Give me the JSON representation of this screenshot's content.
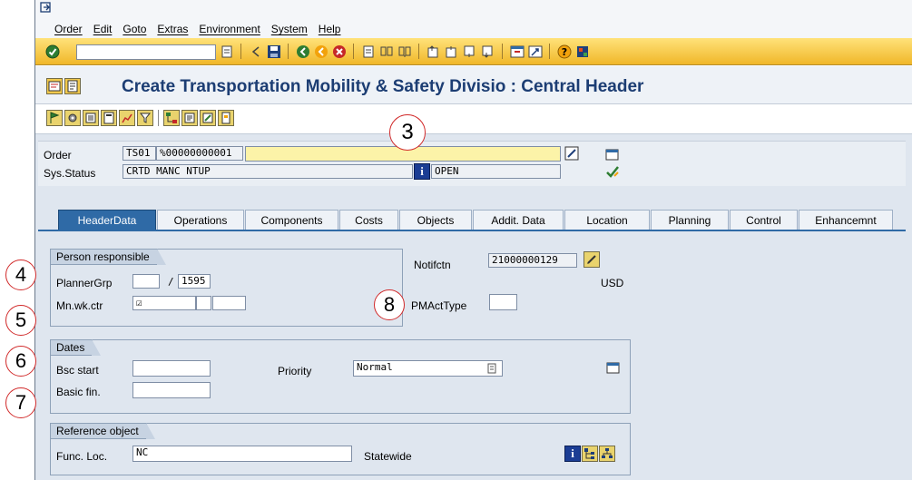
{
  "menu": [
    "Order",
    "Edit",
    "Goto",
    "Extras",
    "Environment",
    "System",
    "Help"
  ],
  "toolbar": {
    "command_value": "",
    "icons": [
      "enter-icon",
      "command-dropdown-icon",
      "back-arrow-icon",
      "save-icon",
      "back-icon",
      "exit-icon",
      "cancel-icon",
      "print-icon",
      "find-icon",
      "find-next-icon",
      "first-page-icon",
      "previous-page-icon",
      "next-page-icon",
      "last-page-icon",
      "new-session-icon",
      "shortcut-icon",
      "help-icon",
      "layout-icon"
    ]
  },
  "title": "Create Transportation Mobility & Safety Divisio : Central Header",
  "header": {
    "order_label": "Order",
    "order_type": "TS01",
    "order_number": "%00000000001",
    "order_description": "",
    "sys_status_label": "Sys.Status",
    "sys_status_value": "CRTD MANC NTUP",
    "user_status_value": "OPEN"
  },
  "tabs": [
    "HeaderData",
    "Operations",
    "Components",
    "Costs",
    "Objects",
    "Addit. Data",
    "Location",
    "Planning",
    "Control",
    "Enhancemnt"
  ],
  "active_tab": "HeaderData",
  "person_responsible": {
    "title": "Person responsible",
    "planner_grp_label": "PlannerGrp",
    "planner_grp_value": "",
    "planning_plant_value": "1595",
    "mn_wk_ctr_label": "Mn.wk.ctr",
    "mn_wk_ctr_value": "☑",
    "mn_wk_ctr_plant_value": "",
    "separator": "/"
  },
  "notification": {
    "label": "Notifctn",
    "value": "21000000129",
    "currency": "USD",
    "pm_act_type_label": "PMActType",
    "pm_act_type_value": ""
  },
  "dates": {
    "title": "Dates",
    "bsc_start_label": "Bsc start",
    "bsc_start_value": "",
    "basic_fin_label": "Basic fin.",
    "basic_fin_value": "",
    "priority_label": "Priority",
    "priority_value": "Normal"
  },
  "reference_object": {
    "title": "Reference object",
    "func_loc_label": "Func. Loc.",
    "func_loc_value": "NC",
    "func_loc_description": "Statewide"
  },
  "callouts": [
    "3",
    "4",
    "5",
    "6",
    "7",
    "8"
  ],
  "colors": {
    "title_blue": "#1c3d73",
    "toolbar_yellow": "#f0b729",
    "active_tab": "#2f6aa6",
    "callout_red": "#d12a2a",
    "required_field": "#fcf3a8"
  }
}
